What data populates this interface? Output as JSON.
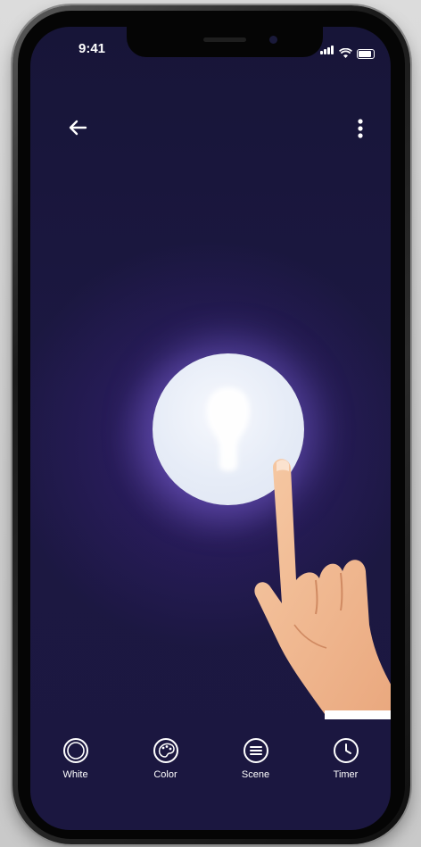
{
  "status_bar": {
    "time": "9:41"
  },
  "header": {
    "back_icon": "arrow-left-icon",
    "menu_icon": "more-vertical-icon"
  },
  "main": {
    "power_icon": "light-bulb-icon",
    "overlay": "pointing-hand-illustration"
  },
  "bottom_nav": {
    "items": [
      {
        "label": "White",
        "icon": "ring-icon"
      },
      {
        "label": "Color",
        "icon": "palette-icon"
      },
      {
        "label": "Scene",
        "icon": "list-circle-icon"
      },
      {
        "label": "Timer",
        "icon": "clock-icon"
      }
    ]
  },
  "colors": {
    "background": "#1a1740",
    "glow": "#7a55d6",
    "bulb": "#e8edf8",
    "text": "#ffffff"
  }
}
